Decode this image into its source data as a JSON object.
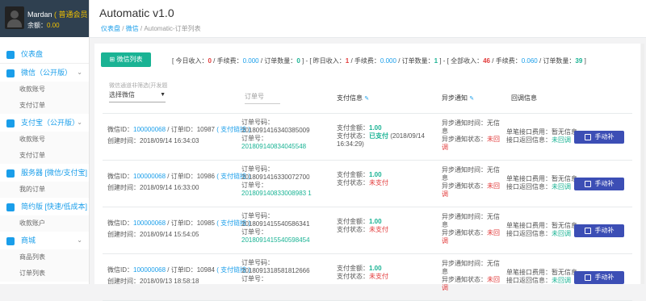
{
  "user": {
    "name": "Mardan",
    "role": "( 普通会员 )",
    "balance_label": "余额：",
    "balance": "0.00"
  },
  "sidebar": {
    "groups": [
      {
        "label": "仪表盘",
        "items": []
      },
      {
        "label": "微信（公开版）",
        "items": [
          "收款账号",
          "支付订单"
        ]
      },
      {
        "label": "支付宝（公开版）",
        "items": [
          "收款账号",
          "支付订单"
        ]
      },
      {
        "label": "服务器 [微信/支付宝]",
        "items": [
          "我的订单"
        ]
      },
      {
        "label": "简约版 [快速/低成本]",
        "items": [
          "收款账户"
        ]
      },
      {
        "label": "商城",
        "items": [
          "商品列表",
          "订单列表"
        ]
      }
    ]
  },
  "header": {
    "title": "Automatic v1.0",
    "breadcrumb": [
      "仪表盘",
      "微信",
      "Automatic-订单列表"
    ]
  },
  "toolbar": {
    "wechat_list": "微信列表"
  },
  "stats": {
    "today_income_label": "[ 今日收入：",
    "today_income": "0",
    "today_fee_label": "/ 手续费：",
    "today_fee": "0.000",
    "today_count_label": "/ 订单数量：",
    "today_count": "0",
    "yest_income_label": "] - [ 昨日收入：",
    "yest_income": "1",
    "yest_fee_label": "/ 手续费：",
    "yest_fee": "0.000",
    "yest_count_label": "/ 订单数量：",
    "yest_count": "1",
    "all_income_label": "] - [ 全部收入：",
    "all_income": "46",
    "all_fee_label": "/ 手续费：",
    "all_fee": "0.060",
    "all_count_label": "/ 订单数量：",
    "all_count": "39",
    "end": "]"
  },
  "filter": {
    "hint": "微信通道非筛选(开发题",
    "select": "选择微信",
    "order_placeholder": "订单号"
  },
  "columns": {
    "pay_info": "支付信息",
    "notify": "异步通知",
    "callback": "回调信息"
  },
  "labels": {
    "wx_id": "微信ID：",
    "order_id": "/ 订单ID：",
    "pay_link": "( 支付链接 )",
    "created": "创建时间：",
    "order_no": "订单号码：",
    "out_no": "订单号：",
    "amount": "支付金额：",
    "status": "支付状态：",
    "notify_time": "异步通知时间：",
    "notify_state": "异步通知状态：",
    "cb_use": "单笔接口费用：",
    "cb_back": "接口返回信息：",
    "manual": "手动补"
  },
  "orders": [
    {
      "wx": "100000068",
      "oid": "10987",
      "time": "2018/09/14 16:34:03",
      "ono": "2018091416340385009",
      "out": "201809140834045548",
      "amount": "1.00",
      "status": "已支付",
      "paid_time": "(2018/09/14 16:34:29)",
      "n_time": "无信息",
      "n_state": "未回调",
      "cb_use": "暂无信息",
      "cb_back": "未回调"
    },
    {
      "wx": "100000068",
      "oid": "10986",
      "time": "2018/09/14 16:33:00",
      "ono": "2018091416330072700",
      "out": "201809140833008983 1",
      "amount": "1.00",
      "status": "未支付",
      "paid_time": "",
      "n_time": "无信息",
      "n_state": "未回调",
      "cb_use": "暂无信息",
      "cb_back": "未回调"
    },
    {
      "wx": "100000068",
      "oid": "10985",
      "time": "2018/09/14 15:54:05",
      "ono": "2018091415540586341",
      "out": "2018091415540598454",
      "amount": "1.00",
      "status": "未支付",
      "paid_time": "",
      "n_time": "无信息",
      "n_state": "未回调",
      "cb_use": "暂无信息",
      "cb_back": "未回调"
    },
    {
      "wx": "100000068",
      "oid": "10984",
      "time": "2018/09/13 18:58:18",
      "ono": "2018091318581812666",
      "out": "",
      "amount": "1.00",
      "status": "未支付",
      "paid_time": "",
      "n_time": "无信息",
      "n_state": "未回调",
      "cb_use": "暂无信息",
      "cb_back": "未回调"
    }
  ]
}
